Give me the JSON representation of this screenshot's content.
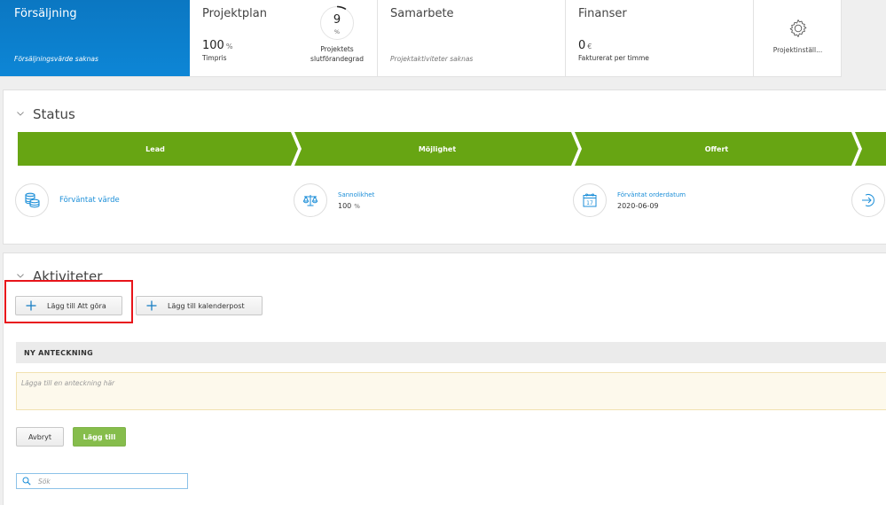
{
  "tiles": {
    "sales": {
      "title": "Försäljning",
      "subtitle": "Försäljningsvärde saknas",
      "bg_color": "#0b7dca"
    },
    "plan": {
      "title": "Projektplan",
      "value": "100",
      "value_unit": "%",
      "value_label": "Timpris",
      "progress": {
        "value": "9",
        "unit": "%",
        "percent": 9,
        "caption_line1": "Projektets",
        "caption_line2": "slutförandegrad"
      }
    },
    "collab": {
      "title": "Samarbete",
      "subtitle": "Projektaktiviteter saknas"
    },
    "finance": {
      "title": "Finanser",
      "value": "0",
      "value_unit": "€",
      "value_label": "Fakturerat per timme"
    },
    "settings": {
      "label": "Projektinställ...",
      "icon": "gear-icon"
    }
  },
  "status": {
    "title": "Status",
    "stages": [
      {
        "label": "Lead"
      },
      {
        "label": "Möjlighet"
      },
      {
        "label": "Offert"
      },
      {
        "label": ""
      }
    ],
    "stage_color": "#67a513",
    "info": {
      "expected_value": {
        "label": "Förväntat värde",
        "icon": "coins-icon"
      },
      "probability": {
        "label": "Sannolikhet",
        "value": "100",
        "unit": "%",
        "icon": "scales-icon"
      },
      "order_date": {
        "label": "Förväntat orderdatum",
        "value": "2020-06-09",
        "icon": "calendar-icon",
        "calendar_day": "17"
      },
      "next": {
        "icon": "arrow-right-circle-icon"
      }
    }
  },
  "activities": {
    "title": "Aktiviteter",
    "add_todo_label": "Lägg till Att göra",
    "add_calendar_label": "Lägg till kalenderpost",
    "new_note": {
      "header": "NY ANTECKNING",
      "placeholder": "Lägga till en anteckning här",
      "value": ""
    },
    "cancel_label": "Avbryt",
    "add_label": "Lägg till",
    "add_color": "#86bd4c",
    "search": {
      "placeholder": "Sök",
      "value": ""
    }
  },
  "accent_color": "#1b8ed8",
  "highlight_color": "#e8141a"
}
